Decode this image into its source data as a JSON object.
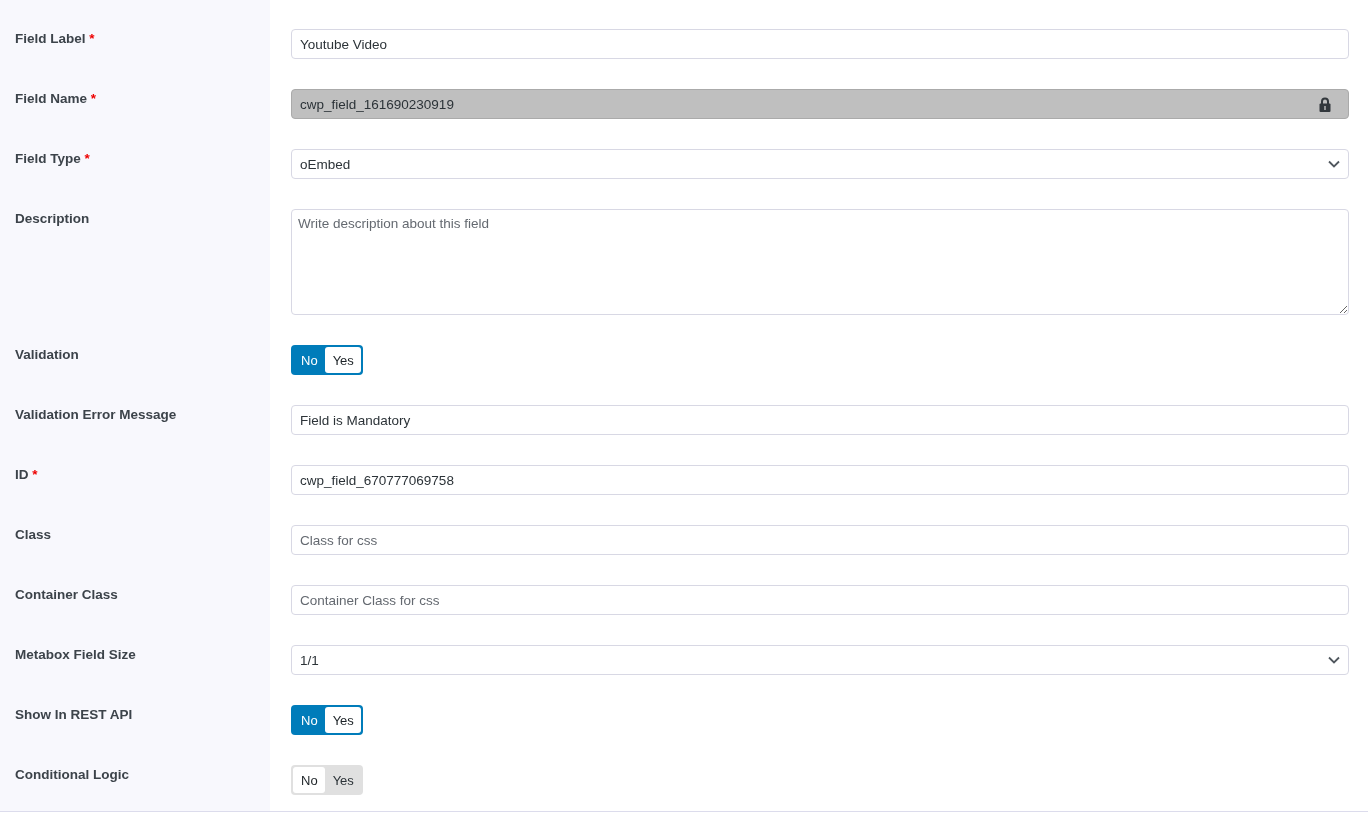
{
  "fields": [
    {
      "label": "Field Label",
      "required": "*",
      "kind": "text",
      "value": "Youtube Video"
    },
    {
      "label": "Field Name",
      "required": "*",
      "kind": "locked",
      "value": "cwp_field_161690230919"
    },
    {
      "label": "Field Type",
      "required": "*",
      "kind": "select",
      "value": "oEmbed"
    },
    {
      "label": "Description",
      "kind": "textarea",
      "placeholder": "Write description about this field"
    },
    {
      "label": "Validation",
      "kind": "toggle",
      "on": true,
      "options": [
        "No",
        "Yes"
      ]
    },
    {
      "label": "Validation Error Message",
      "kind": "text",
      "value": "Field is Mandatory"
    },
    {
      "label": "ID",
      "required": "*",
      "kind": "text",
      "value": "cwp_field_670777069758"
    },
    {
      "label": "Class",
      "kind": "text",
      "placeholder": "Class for css"
    },
    {
      "label": "Container Class",
      "kind": "text",
      "placeholder": "Container Class for css"
    },
    {
      "label": "Metabox Field Size",
      "kind": "select",
      "value": "1/1"
    },
    {
      "label": "Show In REST API",
      "kind": "toggle",
      "on": true,
      "options": [
        "No",
        "Yes"
      ]
    },
    {
      "label": "Conditional Logic",
      "kind": "toggle",
      "on": false,
      "options": [
        "No",
        "Yes"
      ]
    }
  ]
}
